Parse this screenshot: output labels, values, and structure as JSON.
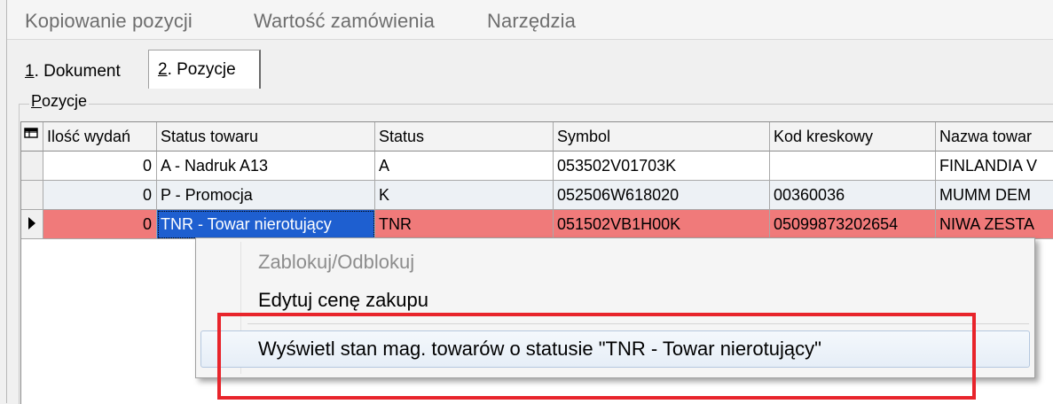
{
  "menu": [
    "Kopiowanie pozycji",
    "Wartość zamówienia",
    "Narzędzia"
  ],
  "tabs": [
    {
      "num": "1",
      "label": ". Dokument"
    },
    {
      "num": "2",
      "label": ". Pozycje"
    }
  ],
  "group": {
    "first": "P",
    "rest": "ozycje"
  },
  "grid": {
    "columns": [
      "Ilość wydań",
      "Status towaru",
      "Status",
      "Symbol",
      "Kod kreskowy",
      "Nazwa towar"
    ],
    "rows": [
      {
        "qty": "0",
        "status_towaru": "A - Nadruk A13",
        "status": "A",
        "symbol": "053502V01703K",
        "kod": "",
        "nazwa": "FINLANDIA V"
      },
      {
        "qty": "0",
        "status_towaru": "P - Promocja",
        "status": "K",
        "symbol": "052506W618020",
        "kod": "00360036",
        "nazwa": "MUMM DEM"
      },
      {
        "qty": "0",
        "status_towaru": "TNR - Towar nierotujący",
        "status": "TNR",
        "symbol": "051502VB1H00K",
        "kod": "05099873202654",
        "nazwa": "NIWA ZESTA"
      }
    ]
  },
  "context_menu": {
    "item1": "Zablokuj/Odblokuj",
    "item2": "Edytuj cenę zakupu",
    "item3": "Wyświetl stan mag. towarów o statusie \"TNR - Towar nierotujący\""
  },
  "colors": {
    "selected_row": "#f07a7a",
    "highlight_box": "#e8242b",
    "selected_cell": "#1e5fd0"
  }
}
